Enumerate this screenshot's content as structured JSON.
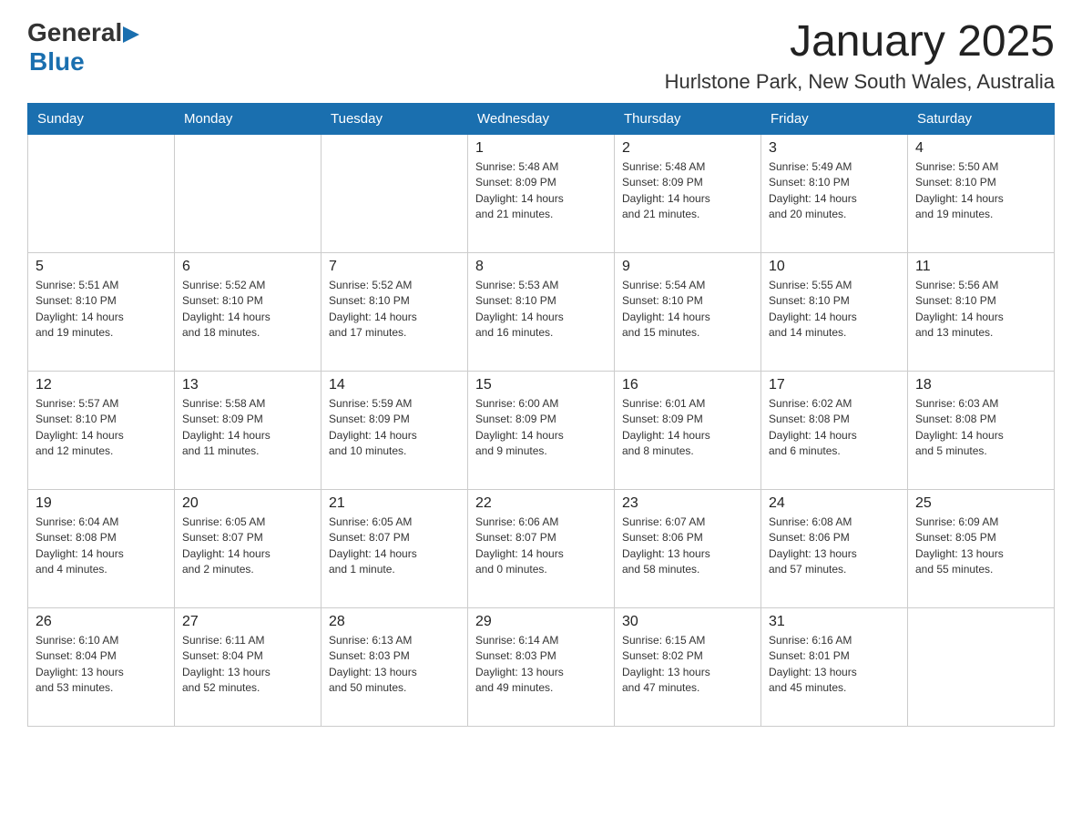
{
  "logo": {
    "text_general": "General",
    "arrow": "▶",
    "text_blue": "Blue"
  },
  "header": {
    "title": "January 2025",
    "subtitle": "Hurlstone Park, New South Wales, Australia"
  },
  "weekdays": [
    "Sunday",
    "Monday",
    "Tuesday",
    "Wednesday",
    "Thursday",
    "Friday",
    "Saturday"
  ],
  "weeks": [
    [
      {
        "day": "",
        "info": ""
      },
      {
        "day": "",
        "info": ""
      },
      {
        "day": "",
        "info": ""
      },
      {
        "day": "1",
        "info": "Sunrise: 5:48 AM\nSunset: 8:09 PM\nDaylight: 14 hours\nand 21 minutes."
      },
      {
        "day": "2",
        "info": "Sunrise: 5:48 AM\nSunset: 8:09 PM\nDaylight: 14 hours\nand 21 minutes."
      },
      {
        "day": "3",
        "info": "Sunrise: 5:49 AM\nSunset: 8:10 PM\nDaylight: 14 hours\nand 20 minutes."
      },
      {
        "day": "4",
        "info": "Sunrise: 5:50 AM\nSunset: 8:10 PM\nDaylight: 14 hours\nand 19 minutes."
      }
    ],
    [
      {
        "day": "5",
        "info": "Sunrise: 5:51 AM\nSunset: 8:10 PM\nDaylight: 14 hours\nand 19 minutes."
      },
      {
        "day": "6",
        "info": "Sunrise: 5:52 AM\nSunset: 8:10 PM\nDaylight: 14 hours\nand 18 minutes."
      },
      {
        "day": "7",
        "info": "Sunrise: 5:52 AM\nSunset: 8:10 PM\nDaylight: 14 hours\nand 17 minutes."
      },
      {
        "day": "8",
        "info": "Sunrise: 5:53 AM\nSunset: 8:10 PM\nDaylight: 14 hours\nand 16 minutes."
      },
      {
        "day": "9",
        "info": "Sunrise: 5:54 AM\nSunset: 8:10 PM\nDaylight: 14 hours\nand 15 minutes."
      },
      {
        "day": "10",
        "info": "Sunrise: 5:55 AM\nSunset: 8:10 PM\nDaylight: 14 hours\nand 14 minutes."
      },
      {
        "day": "11",
        "info": "Sunrise: 5:56 AM\nSunset: 8:10 PM\nDaylight: 14 hours\nand 13 minutes."
      }
    ],
    [
      {
        "day": "12",
        "info": "Sunrise: 5:57 AM\nSunset: 8:10 PM\nDaylight: 14 hours\nand 12 minutes."
      },
      {
        "day": "13",
        "info": "Sunrise: 5:58 AM\nSunset: 8:09 PM\nDaylight: 14 hours\nand 11 minutes."
      },
      {
        "day": "14",
        "info": "Sunrise: 5:59 AM\nSunset: 8:09 PM\nDaylight: 14 hours\nand 10 minutes."
      },
      {
        "day": "15",
        "info": "Sunrise: 6:00 AM\nSunset: 8:09 PM\nDaylight: 14 hours\nand 9 minutes."
      },
      {
        "day": "16",
        "info": "Sunrise: 6:01 AM\nSunset: 8:09 PM\nDaylight: 14 hours\nand 8 minutes."
      },
      {
        "day": "17",
        "info": "Sunrise: 6:02 AM\nSunset: 8:08 PM\nDaylight: 14 hours\nand 6 minutes."
      },
      {
        "day": "18",
        "info": "Sunrise: 6:03 AM\nSunset: 8:08 PM\nDaylight: 14 hours\nand 5 minutes."
      }
    ],
    [
      {
        "day": "19",
        "info": "Sunrise: 6:04 AM\nSunset: 8:08 PM\nDaylight: 14 hours\nand 4 minutes."
      },
      {
        "day": "20",
        "info": "Sunrise: 6:05 AM\nSunset: 8:07 PM\nDaylight: 14 hours\nand 2 minutes."
      },
      {
        "day": "21",
        "info": "Sunrise: 6:05 AM\nSunset: 8:07 PM\nDaylight: 14 hours\nand 1 minute."
      },
      {
        "day": "22",
        "info": "Sunrise: 6:06 AM\nSunset: 8:07 PM\nDaylight: 14 hours\nand 0 minutes."
      },
      {
        "day": "23",
        "info": "Sunrise: 6:07 AM\nSunset: 8:06 PM\nDaylight: 13 hours\nand 58 minutes."
      },
      {
        "day": "24",
        "info": "Sunrise: 6:08 AM\nSunset: 8:06 PM\nDaylight: 13 hours\nand 57 minutes."
      },
      {
        "day": "25",
        "info": "Sunrise: 6:09 AM\nSunset: 8:05 PM\nDaylight: 13 hours\nand 55 minutes."
      }
    ],
    [
      {
        "day": "26",
        "info": "Sunrise: 6:10 AM\nSunset: 8:04 PM\nDaylight: 13 hours\nand 53 minutes."
      },
      {
        "day": "27",
        "info": "Sunrise: 6:11 AM\nSunset: 8:04 PM\nDaylight: 13 hours\nand 52 minutes."
      },
      {
        "day": "28",
        "info": "Sunrise: 6:13 AM\nSunset: 8:03 PM\nDaylight: 13 hours\nand 50 minutes."
      },
      {
        "day": "29",
        "info": "Sunrise: 6:14 AM\nSunset: 8:03 PM\nDaylight: 13 hours\nand 49 minutes."
      },
      {
        "day": "30",
        "info": "Sunrise: 6:15 AM\nSunset: 8:02 PM\nDaylight: 13 hours\nand 47 minutes."
      },
      {
        "day": "31",
        "info": "Sunrise: 6:16 AM\nSunset: 8:01 PM\nDaylight: 13 hours\nand 45 minutes."
      },
      {
        "day": "",
        "info": ""
      }
    ]
  ]
}
